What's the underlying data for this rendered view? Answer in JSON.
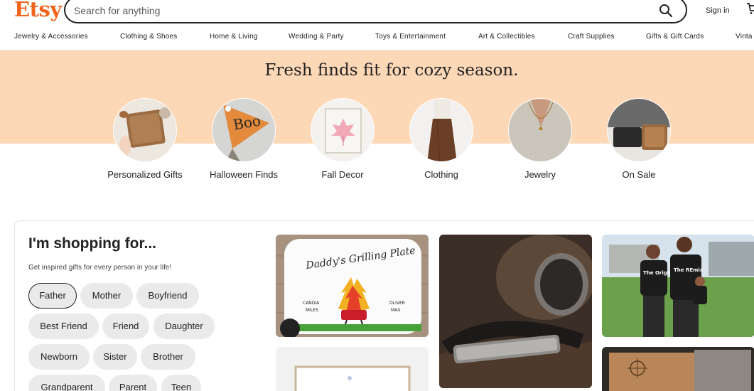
{
  "header": {
    "logo": "Etsy",
    "search_placeholder": "Search for anything",
    "signin": "Sign in"
  },
  "categories_nav": [
    "Jewelry & Accessories",
    "Clothing & Shoes",
    "Home & Living",
    "Wedding & Party",
    "Toys & Entertainment",
    "Art & Collectibles",
    "Craft Supplies",
    "Gifts & Gift Cards",
    "Vinta"
  ],
  "hero": {
    "title": "Fresh finds fit for cozy season.",
    "circles": [
      {
        "label": "Personalized Gifts"
      },
      {
        "label": "Halloween Finds"
      },
      {
        "label": "Fall Decor"
      },
      {
        "label": "Clothing"
      },
      {
        "label": "Jewelry"
      },
      {
        "label": "On Sale"
      }
    ]
  },
  "shopping": {
    "title": "I'm shopping for...",
    "subtitle": "Get inspired gifts for every person in your life!",
    "chips": [
      "Father",
      "Mother",
      "Boyfriend",
      "Best Friend",
      "Friend",
      "Daughter",
      "Newborn",
      "Sister",
      "Brother",
      "Grandparent",
      "Parent",
      "Teen"
    ],
    "selected": "Father"
  },
  "tiles": {
    "plate_title": "Daddy's Grilling Plate",
    "plate_names": [
      "CANDIA",
      "MILES",
      "OLIVER",
      "MAX"
    ],
    "shirt_left": "The Original",
    "shirt_right": "The REmix."
  },
  "colors": {
    "brand": "#F1641E",
    "hero_band": "#FDD8B7",
    "chip_bg": "#EAEAEA"
  }
}
